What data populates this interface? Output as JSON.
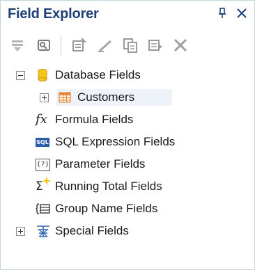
{
  "panel": {
    "title": "Field Explorer",
    "pin_glyph": "⨎",
    "close_glyph": "✕"
  },
  "toolbar": {
    "buttons": [
      {
        "icon": "insert-to-report-icon"
      },
      {
        "icon": "browse-icon"
      },
      {
        "icon": "new-icon"
      },
      {
        "icon": "edit-icon"
      },
      {
        "icon": "duplicate-icon"
      },
      {
        "icon": "rename-icon"
      },
      {
        "icon": "delete-icon"
      }
    ]
  },
  "tree": {
    "items": [
      {
        "label": "Database Fields",
        "icon": "database-icon",
        "expander": "minus"
      },
      {
        "label": "Customers",
        "icon": "table-icon",
        "expander": "plus"
      },
      {
        "label": "Formula Fields",
        "icon": "formula-icon",
        "icon_text": "fx"
      },
      {
        "label": "SQL Expression Fields",
        "icon": "sql-icon",
        "icon_text": "SQL"
      },
      {
        "label": "Parameter Fields",
        "icon": "parameter-icon",
        "icon_text": "(?)"
      },
      {
        "label": "Running Total Fields",
        "icon": "running-total-icon",
        "icon_text": "Σ"
      },
      {
        "label": "Group Name Fields",
        "icon": "group-name-icon"
      },
      {
        "label": "Special Fields",
        "icon": "special-fields-icon",
        "expander": "plus"
      }
    ]
  },
  "colors": {
    "title": "#1f3f77",
    "accent_yellow": "#f5c518",
    "table_orange": "#e8883a",
    "sql_blue": "#2b5aa8"
  }
}
